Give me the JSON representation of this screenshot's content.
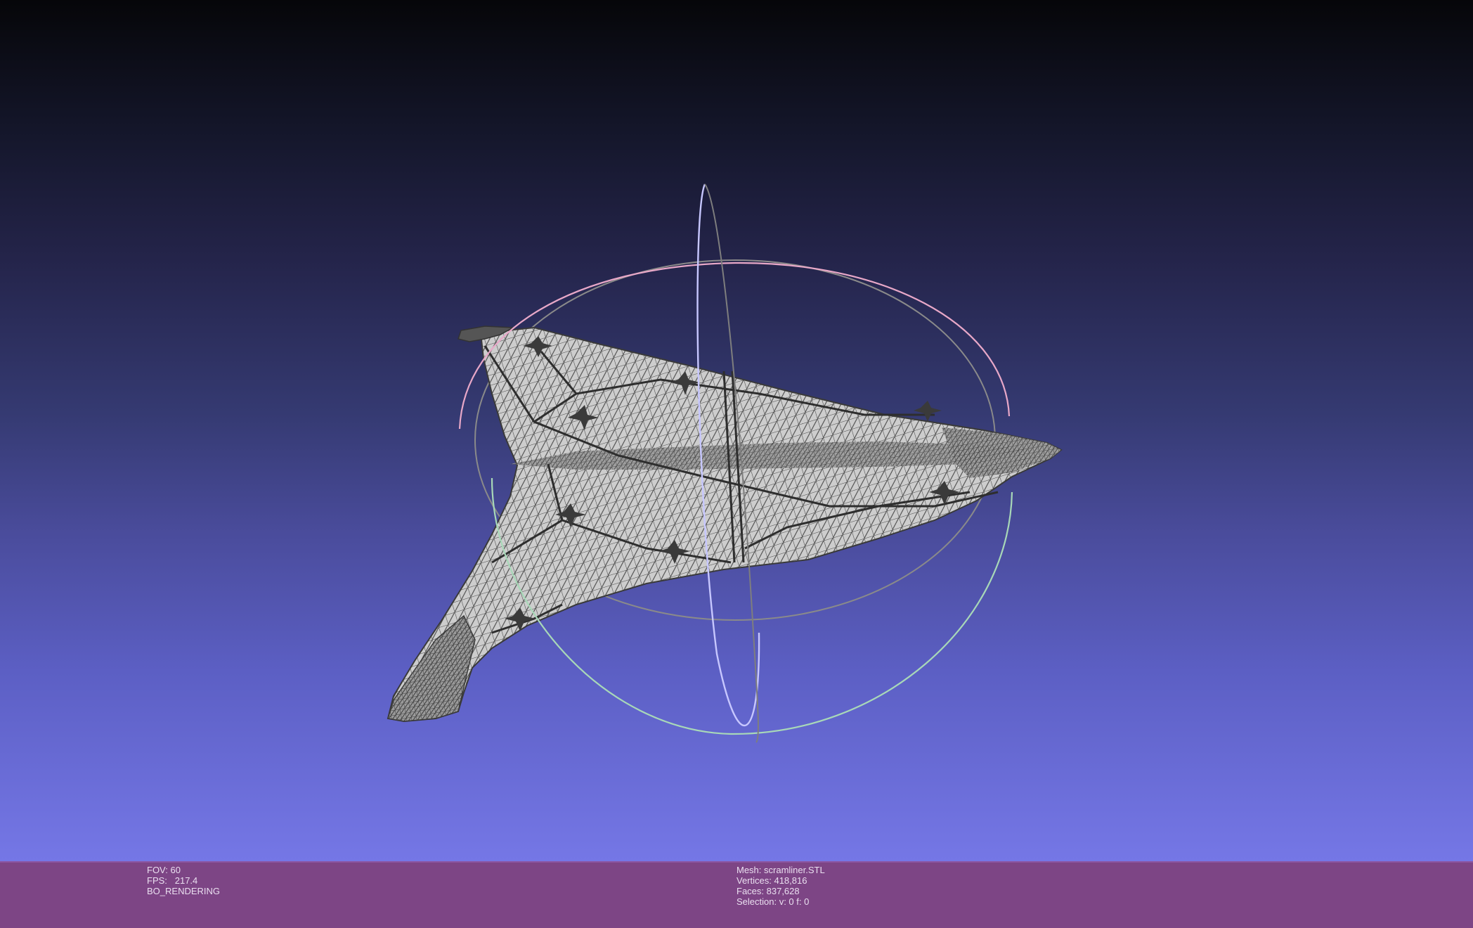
{
  "viewport": {
    "mesh_name": "scramliner.STL",
    "render_mode": "wireframe"
  },
  "info_left": {
    "fov": "FOV: 60",
    "fps": "FPS:   217.4",
    "rendering": "BO_RENDERING"
  },
  "info_right": {
    "mesh": "Mesh: scramliner.STL",
    "vertices": "Vertices: 418,816",
    "faces": "Faces: 837,628",
    "selection": "Selection: v: 0 f: 0"
  },
  "colors": {
    "info_bar": "#7d4585",
    "mesh_fill": "#c9c9c9",
    "mesh_wire": "#3a3a3a",
    "trackball_x": "#c7c7ff",
    "trackball_y": "#f2a8c8",
    "trackball_z": "#b6e0b6"
  }
}
